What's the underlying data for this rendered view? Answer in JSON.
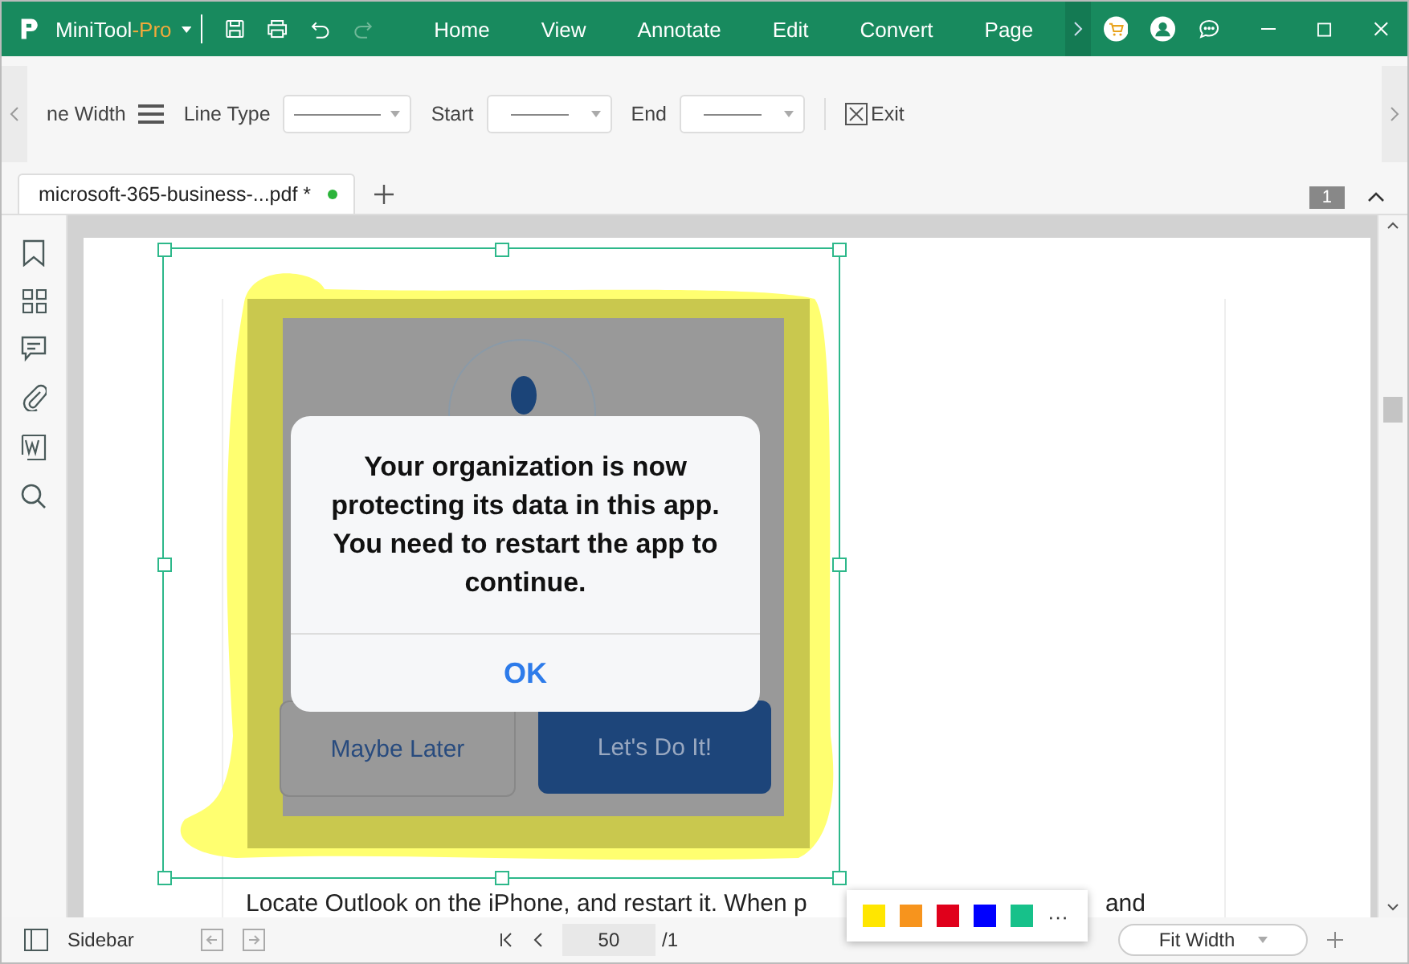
{
  "app": {
    "logo_text": "MiniTool",
    "logo_suffix": "-Pro"
  },
  "menu": [
    "Home",
    "View",
    "Annotate",
    "Edit",
    "Convert",
    "Page"
  ],
  "toolbar": {
    "line_width_label": "ne Width",
    "line_type_label": "Line Type",
    "start_label": "Start",
    "end_label": "End",
    "exit_label": "Exit"
  },
  "tabs": [
    {
      "label": "microsoft-365-business-...pdf *",
      "selected": true,
      "modified": true
    }
  ],
  "page_count_badge": "1",
  "dialog": {
    "message": "Your organization is now protecting its data in this app. You need to restart the app to continue.",
    "ok": "OK",
    "secondary": "Maybe Later",
    "primary": "Let's Do It!"
  },
  "body_text": [
    "Locate Outlook on the iPhone, and restart it. When p",
    "and"
  ],
  "status": {
    "sidebar_label": "Sidebar",
    "page_value": "50",
    "page_total": "/1",
    "zoom": "Fit Width"
  },
  "highlight_colors": [
    {
      "color": "#ffe600"
    },
    {
      "color": "#f7941d"
    },
    {
      "color": "#e0001b"
    },
    {
      "color": "#0000ff"
    },
    {
      "color": "#17c18a"
    }
  ],
  "more_label": "···"
}
